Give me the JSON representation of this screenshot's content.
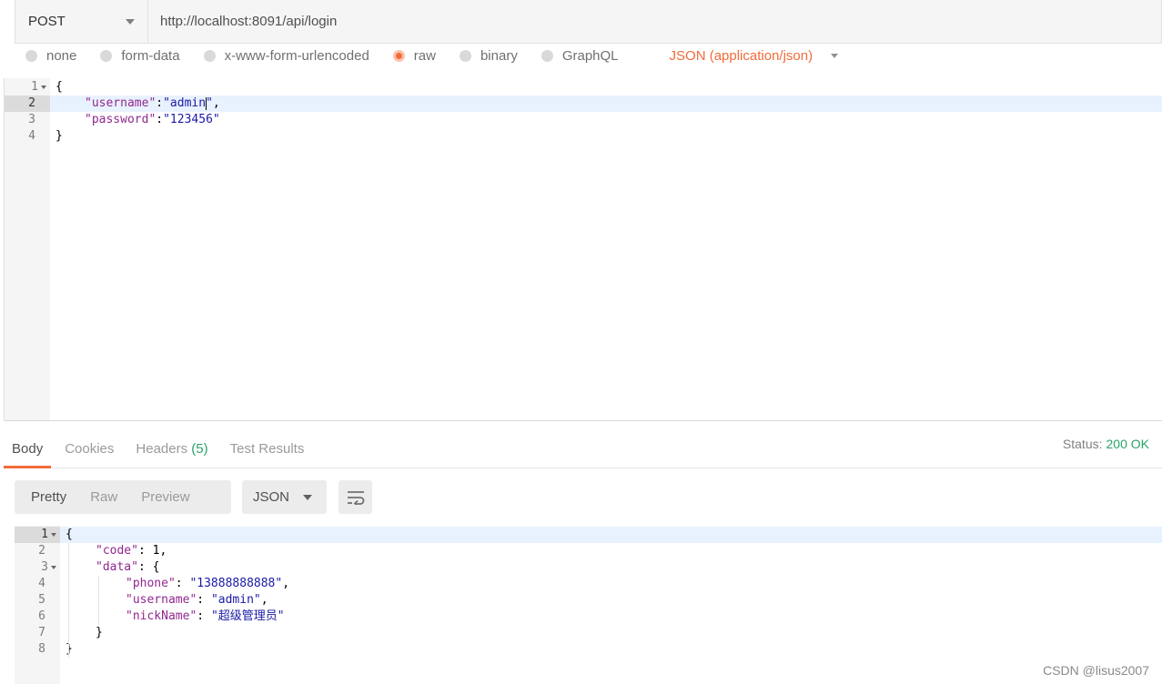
{
  "request": {
    "method": "POST",
    "url": "http://localhost:8091/api/login",
    "body_types": [
      {
        "label": "none",
        "selected": false
      },
      {
        "label": "form-data",
        "selected": false
      },
      {
        "label": "x-www-form-urlencoded",
        "selected": false
      },
      {
        "label": "raw",
        "selected": true
      },
      {
        "label": "binary",
        "selected": false
      },
      {
        "label": "GraphQL",
        "selected": false
      }
    ],
    "content_type": "JSON (application/json)",
    "body_lines": [
      {
        "num": "1",
        "text": "{"
      },
      {
        "num": "2",
        "key": "\"username\"",
        "sep": ":",
        "val": "\"admin\"",
        "end": ","
      },
      {
        "num": "3",
        "key": "\"password\"",
        "sep": ":",
        "val": "\"123456\"",
        "end": ""
      },
      {
        "num": "4",
        "text": "}"
      }
    ]
  },
  "response": {
    "tabs": [
      {
        "label": "Body",
        "active": true
      },
      {
        "label": "Cookies",
        "active": false
      },
      {
        "label": "Headers",
        "count": "(5)",
        "active": false
      },
      {
        "label": "Test Results",
        "active": false
      }
    ],
    "status_label": "Status:",
    "status_value": "200 OK",
    "views": [
      "Pretty",
      "Raw",
      "Preview"
    ],
    "active_view": "Pretty",
    "format": "JSON",
    "body_lines": [
      {
        "num": "1",
        "text": "{"
      },
      {
        "num": "2",
        "key": "\"code\"",
        "sep": ": ",
        "val": "1",
        "end": ","
      },
      {
        "num": "3",
        "key": "\"data\"",
        "sep": ": ",
        "val": "{",
        "end": ""
      },
      {
        "num": "4",
        "key": "\"phone\"",
        "sep": ": ",
        "val": "\"13888888888\"",
        "end": ","
      },
      {
        "num": "5",
        "key": "\"username\"",
        "sep": ": ",
        "val": "\"admin\"",
        "end": ","
      },
      {
        "num": "6",
        "key": "\"nickName\"",
        "sep": ": ",
        "val": "\"超级管理员\"",
        "end": ""
      },
      {
        "num": "7",
        "text": "}"
      },
      {
        "num": "8",
        "text": "}"
      }
    ]
  },
  "watermark": "CSDN @lisus2007",
  "colors": {
    "accent": "#f26b3a",
    "success": "#2aa36b",
    "json_key": "#92278f",
    "json_string": "#1a1aa6"
  }
}
